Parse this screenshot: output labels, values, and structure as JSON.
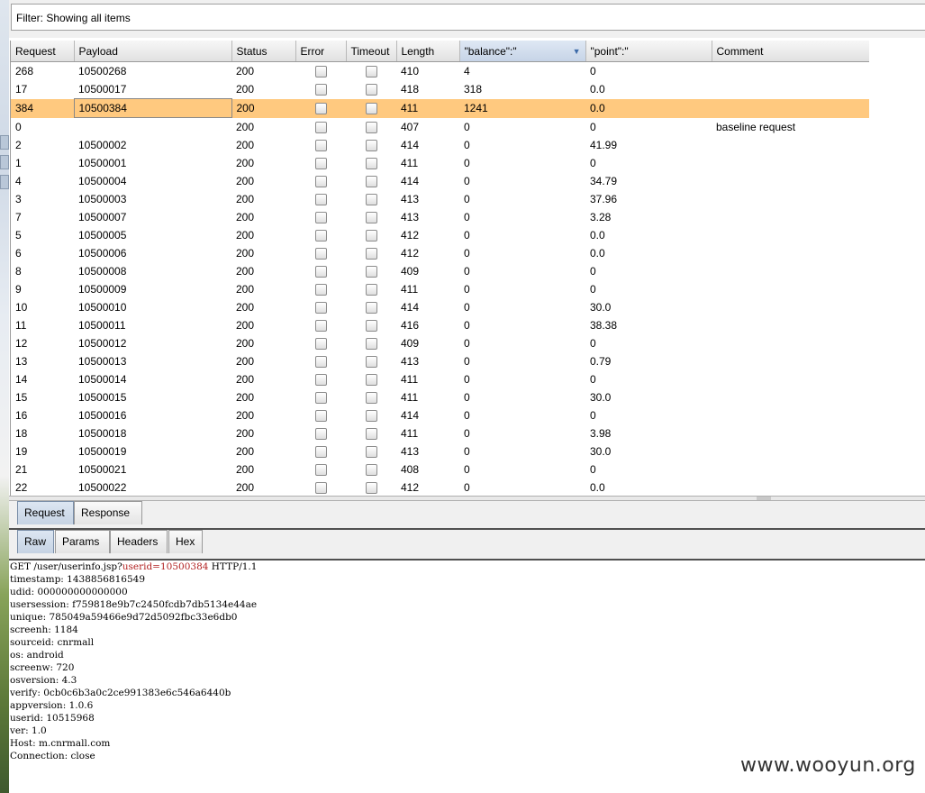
{
  "filter": {
    "text": "Filter: Showing all items"
  },
  "table": {
    "columns": [
      "Request",
      "Payload",
      "Status",
      "Error",
      "Timeout",
      "Length",
      "\"balance\":\"",
      "\"point\":\"",
      "Comment"
    ],
    "sorted_column_index": 6,
    "rows": [
      {
        "request": "268",
        "payload": "10500268",
        "status": "200",
        "length": "410",
        "balance": "4",
        "point": "0",
        "comment": ""
      },
      {
        "request": "17",
        "payload": "10500017",
        "status": "200",
        "length": "418",
        "balance": "318",
        "point": "0.0",
        "comment": ""
      },
      {
        "request": "384",
        "payload": "10500384",
        "status": "200",
        "length": "411",
        "balance": "1241",
        "point": "0.0",
        "comment": "",
        "selected": true
      },
      {
        "request": "0",
        "payload": "",
        "status": "200",
        "length": "407",
        "balance": "0",
        "point": "0",
        "comment": "baseline request"
      },
      {
        "request": "2",
        "payload": "10500002",
        "status": "200",
        "length": "414",
        "balance": "0",
        "point": "41.99",
        "comment": ""
      },
      {
        "request": "1",
        "payload": "10500001",
        "status": "200",
        "length": "411",
        "balance": "0",
        "point": "0",
        "comment": ""
      },
      {
        "request": "4",
        "payload": "10500004",
        "status": "200",
        "length": "414",
        "balance": "0",
        "point": "34.79",
        "comment": ""
      },
      {
        "request": "3",
        "payload": "10500003",
        "status": "200",
        "length": "413",
        "balance": "0",
        "point": "37.96",
        "comment": ""
      },
      {
        "request": "7",
        "payload": "10500007",
        "status": "200",
        "length": "413",
        "balance": "0",
        "point": "3.28",
        "comment": ""
      },
      {
        "request": "5",
        "payload": "10500005",
        "status": "200",
        "length": "412",
        "balance": "0",
        "point": "0.0",
        "comment": ""
      },
      {
        "request": "6",
        "payload": "10500006",
        "status": "200",
        "length": "412",
        "balance": "0",
        "point": "0.0",
        "comment": ""
      },
      {
        "request": "8",
        "payload": "10500008",
        "status": "200",
        "length": "409",
        "balance": "0",
        "point": "0",
        "comment": ""
      },
      {
        "request": "9",
        "payload": "10500009",
        "status": "200",
        "length": "411",
        "balance": "0",
        "point": "0",
        "comment": ""
      },
      {
        "request": "10",
        "payload": "10500010",
        "status": "200",
        "length": "414",
        "balance": "0",
        "point": "30.0",
        "comment": ""
      },
      {
        "request": "11",
        "payload": "10500011",
        "status": "200",
        "length": "416",
        "balance": "0",
        "point": "38.38",
        "comment": ""
      },
      {
        "request": "12",
        "payload": "10500012",
        "status": "200",
        "length": "409",
        "balance": "0",
        "point": "0",
        "comment": ""
      },
      {
        "request": "13",
        "payload": "10500013",
        "status": "200",
        "length": "413",
        "balance": "0",
        "point": "0.79",
        "comment": ""
      },
      {
        "request": "14",
        "payload": "10500014",
        "status": "200",
        "length": "411",
        "balance": "0",
        "point": "0",
        "comment": ""
      },
      {
        "request": "15",
        "payload": "10500015",
        "status": "200",
        "length": "411",
        "balance": "0",
        "point": "30.0",
        "comment": ""
      },
      {
        "request": "16",
        "payload": "10500016",
        "status": "200",
        "length": "414",
        "balance": "0",
        "point": "0",
        "comment": ""
      },
      {
        "request": "18",
        "payload": "10500018",
        "status": "200",
        "length": "411",
        "balance": "0",
        "point": "3.98",
        "comment": ""
      },
      {
        "request": "19",
        "payload": "10500019",
        "status": "200",
        "length": "413",
        "balance": "0",
        "point": "30.0",
        "comment": ""
      },
      {
        "request": "21",
        "payload": "10500021",
        "status": "200",
        "length": "408",
        "balance": "0",
        "point": "0",
        "comment": ""
      },
      {
        "request": "22",
        "payload": "10500022",
        "status": "200",
        "length": "412",
        "balance": "0",
        "point": "0.0",
        "comment": ""
      }
    ]
  },
  "tabs_top": {
    "request": "Request",
    "response": "Response",
    "active": "Request"
  },
  "tabs_sub": {
    "raw": "Raw",
    "params": "Params",
    "headers": "Headers",
    "hex": "Hex",
    "active": "Raw"
  },
  "raw": {
    "request_line_prefix": "GET /user/userinfo.jsp?",
    "request_line_param": "userid=10500384",
    "request_line_suffix": " HTTP/1.1",
    "lines": [
      "timestamp: 1438856816549",
      "udid: 000000000000000",
      "usersession: f759818e9b7c2450fcdb7db5134e44ae",
      "unique: 785049a59466e9d72d5092fbc33e6db0",
      "screenh: 1184",
      "sourceid: cnrmall",
      "os: android",
      "screenw: 720",
      "osversion: 4.3",
      "verify: 0cb0c6b3a0c2ce991383e6c546a6440b",
      "appversion: 1.0.6",
      "userid: 10515968",
      "ver: 1.0",
      "Host: m.cnrmall.com",
      "Connection: close"
    ]
  },
  "watermark": "www.wooyun.org",
  "colors": {
    "selected_row": "#ffc97f",
    "active_tab": "#c6d3e3",
    "param_highlight": "#b22222"
  }
}
